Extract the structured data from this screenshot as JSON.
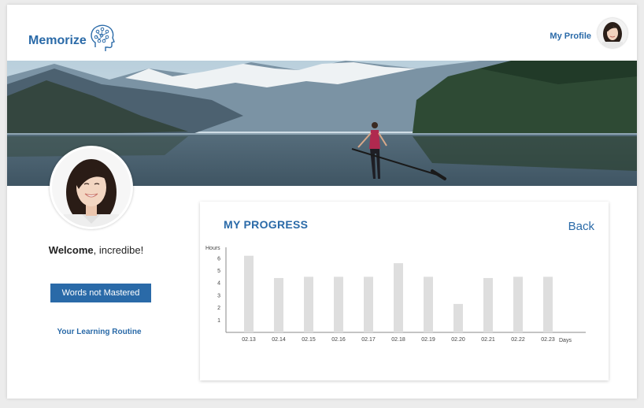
{
  "header": {
    "logo_text": "Memorize",
    "profile_link": "My Profile"
  },
  "sidebar": {
    "welcome_bold": "Welcome",
    "welcome_rest": ", incredibe!",
    "words_button": "Words not Mastered",
    "routine_link": "Your Learning Routine"
  },
  "progress": {
    "title": "MY PROGRESS",
    "back_label": "Back"
  },
  "colors": {
    "accent": "#2a6aa8",
    "bar": "#dedede"
  },
  "chart_data": {
    "type": "bar",
    "ylabel": "Hours",
    "xlabel": "Days",
    "categories": [
      "02.13",
      "02.14",
      "02.15",
      "02.16",
      "02.17",
      "02.18",
      "02.19",
      "02.20",
      "02.21",
      "02.22",
      "02.23"
    ],
    "values": [
      6.2,
      4.4,
      4.5,
      4.5,
      4.5,
      5.6,
      4.5,
      2.3,
      4.4,
      4.5,
      4.5
    ],
    "yticks": [
      1,
      2,
      3,
      4,
      5,
      6
    ],
    "ylim": [
      0,
      6.5
    ],
    "grid": false
  }
}
